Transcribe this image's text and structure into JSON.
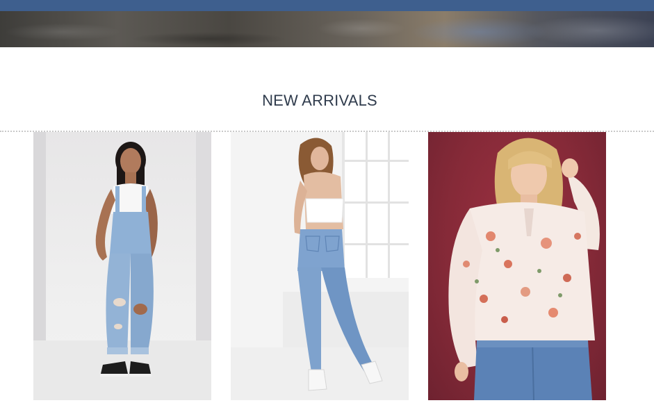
{
  "banner": {
    "nav_color": "#3e5f8e"
  },
  "section": {
    "title": "NEW ARRIVALS"
  },
  "products": [
    {
      "name": "product-image-overalls",
      "icon": "denim-overalls-photo"
    },
    {
      "name": "product-image-jeans",
      "icon": "light-wash-jeans-photo"
    },
    {
      "name": "product-image-floral-blouse",
      "icon": "floral-blouse-photo"
    }
  ],
  "colors": {
    "heading": "#2f3b4c",
    "divider": "#c9c9c9",
    "backdrop_red": "#862a38",
    "denim_light": "#8fb1d6",
    "denim_medium": "#6b90c0"
  }
}
